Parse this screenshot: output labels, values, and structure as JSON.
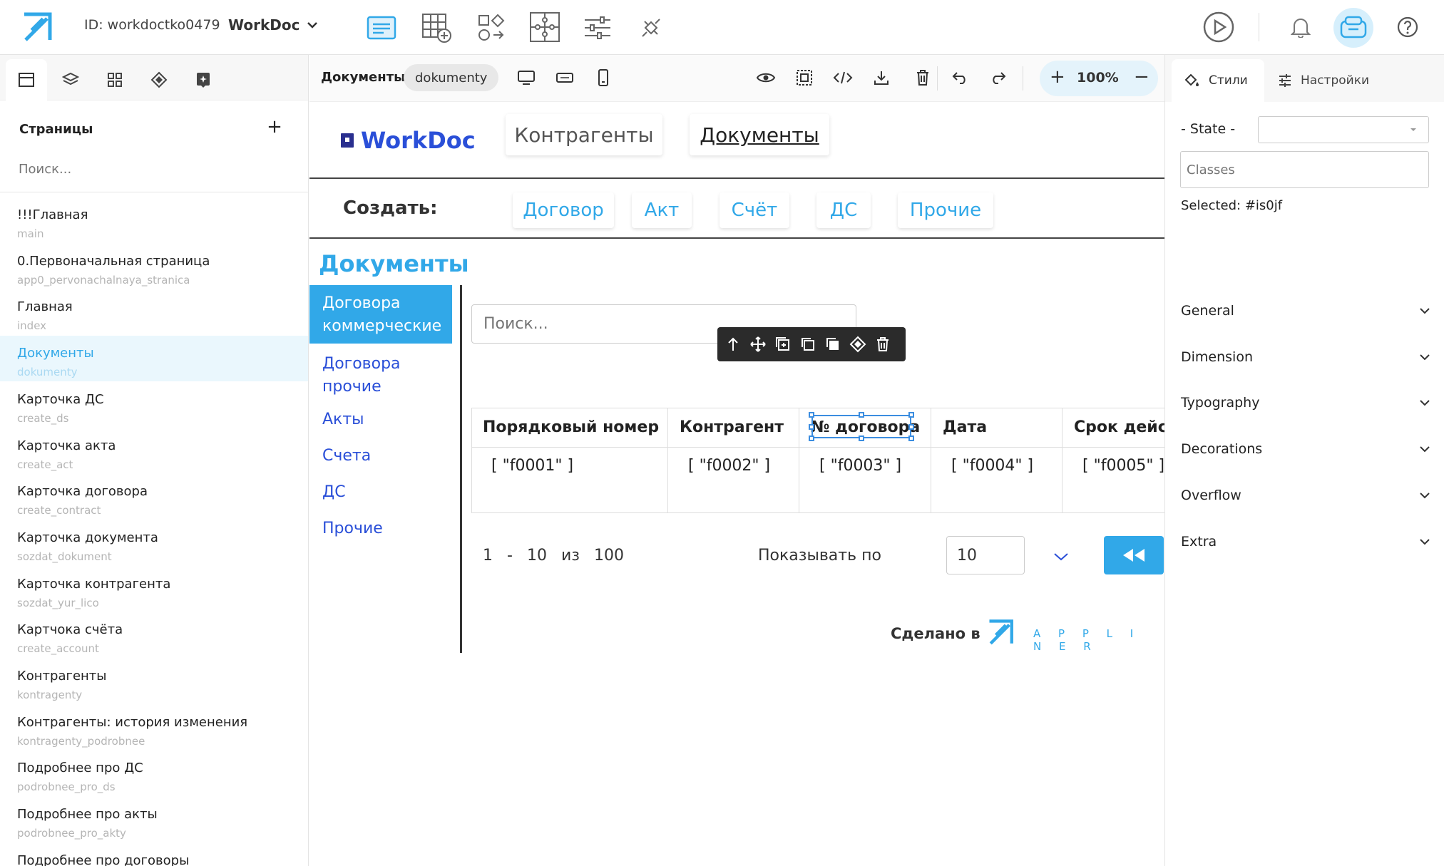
{
  "app": {
    "id_label": "ID: workdoctko0479",
    "project_name": "WorkDoc"
  },
  "left_panel": {
    "title": "Страницы",
    "add_label": "+",
    "search_placeholder": "Поиск...",
    "pages": [
      {
        "name": "!!!Главная",
        "slug": "main"
      },
      {
        "name": "0.Первоначальная страница",
        "slug": "app0_pervonachalnaya_stranica"
      },
      {
        "name": "Главная",
        "slug": "index"
      },
      {
        "name": "Документы",
        "slug": "dokumenty",
        "active": true
      },
      {
        "name": "Карточка ДС",
        "slug": "create_ds"
      },
      {
        "name": "Карточка акта",
        "slug": "create_act"
      },
      {
        "name": "Карточка договора",
        "slug": "create_contract"
      },
      {
        "name": "Карточка документа",
        "slug": "sozdat_dokument"
      },
      {
        "name": "Карточка контрагента",
        "slug": "sozdat_yur_lico"
      },
      {
        "name": "Картчока счёта",
        "slug": "create_account"
      },
      {
        "name": "Контрагенты",
        "slug": "kontragenty"
      },
      {
        "name": "Контрагенты: история изменения",
        "slug": "kontragenty_podrobnee"
      },
      {
        "name": "Подробнее про ДС",
        "slug": "podrobnee_pro_ds"
      },
      {
        "name": "Подробнее про акты",
        "slug": "podrobnee_pro_akty"
      },
      {
        "name": "Подробнее про договоры",
        "slug": ""
      }
    ]
  },
  "canvas_toolbar": {
    "page_title": "Документы",
    "page_slug": "dokumenty",
    "zoom": "100%",
    "zoom_in": "+",
    "zoom_out": "−"
  },
  "canvas": {
    "brand": "WorkDoc",
    "nav": [
      "Контрагенты",
      "Документы"
    ],
    "create_label": "Создать:",
    "create_buttons": [
      "Договор",
      "Акт",
      "Счёт",
      "ДС",
      "Прочие"
    ],
    "section_title": "Документы",
    "sidebar": [
      {
        "label": "Договора коммерческие",
        "active": true
      },
      {
        "label": "Договора прочие"
      },
      {
        "label": "Акты"
      },
      {
        "label": "Счета"
      },
      {
        "label": "ДС"
      },
      {
        "label": "Прочие"
      }
    ],
    "search_placeholder": "Поиск...",
    "table": {
      "headers": [
        "Порядковый номер",
        "Контрагент",
        "№ договора",
        "Дата",
        "Срок действия"
      ],
      "row": [
        "[ \"f0001\" ]",
        "[ \"f0002\" ]",
        "[ \"f0003\" ]",
        "[ \"f0004\" ]",
        "[ \"f0005\" ]"
      ]
    },
    "pagination": {
      "from": "1",
      "dash": "-",
      "to": "10",
      "of": "из",
      "total": "100",
      "per_page_label": "Показывать по",
      "per_page_value": "10"
    },
    "footer": {
      "made_in": "Сделано в",
      "brand_letters": "A P P L I N E R"
    }
  },
  "right_panel": {
    "tabs": [
      "Стили",
      "Настройки"
    ],
    "state_label": "- State -",
    "classes_placeholder": "Classes",
    "selected_text": "Selected: #is0jf",
    "sections": [
      "General",
      "Dimension",
      "Typography",
      "Decorations",
      "Overflow",
      "Extra"
    ]
  },
  "colors": {
    "accent": "#31a8e8",
    "brand_blue": "#2a4fd8",
    "toolbar_dark": "#2b2b2b"
  }
}
